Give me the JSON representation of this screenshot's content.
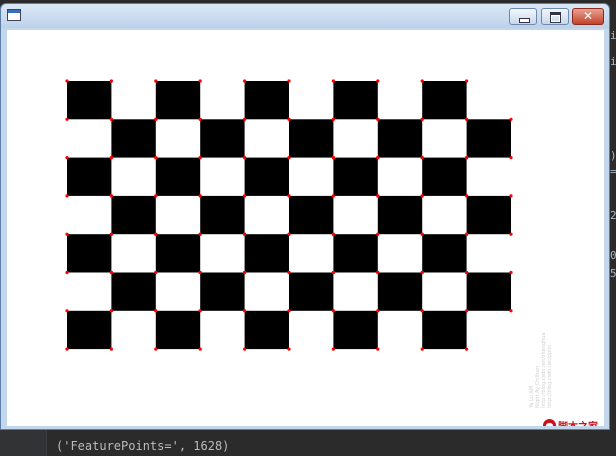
{
  "window": {
    "title": "",
    "controls": {
      "minimize": "minimize",
      "maximize": "maximize",
      "close": "✕"
    }
  },
  "image": {
    "board": {
      "rows": 7,
      "cols": 10,
      "first_row_starts_with": "black"
    },
    "corner_marker_color": "#ff0000",
    "square_color": "#000000",
    "background_color": "#ffffff"
  },
  "watermark": {
    "lines": [
      "Ya Lu AM",
      "Night Ay Chillsen",
      "http://blog.csdn.net/zhanghua",
      "http://blog.csdn.net/pplin"
    ]
  },
  "brand": {
    "text": "脚本之家"
  },
  "background": {
    "console_line": "('FeaturePoints=', 1628)",
    "right_edge_fragments": [
      "in",
      "in",
      ")",
      "=",
      "2",
      "0",
      "5"
    ]
  }
}
